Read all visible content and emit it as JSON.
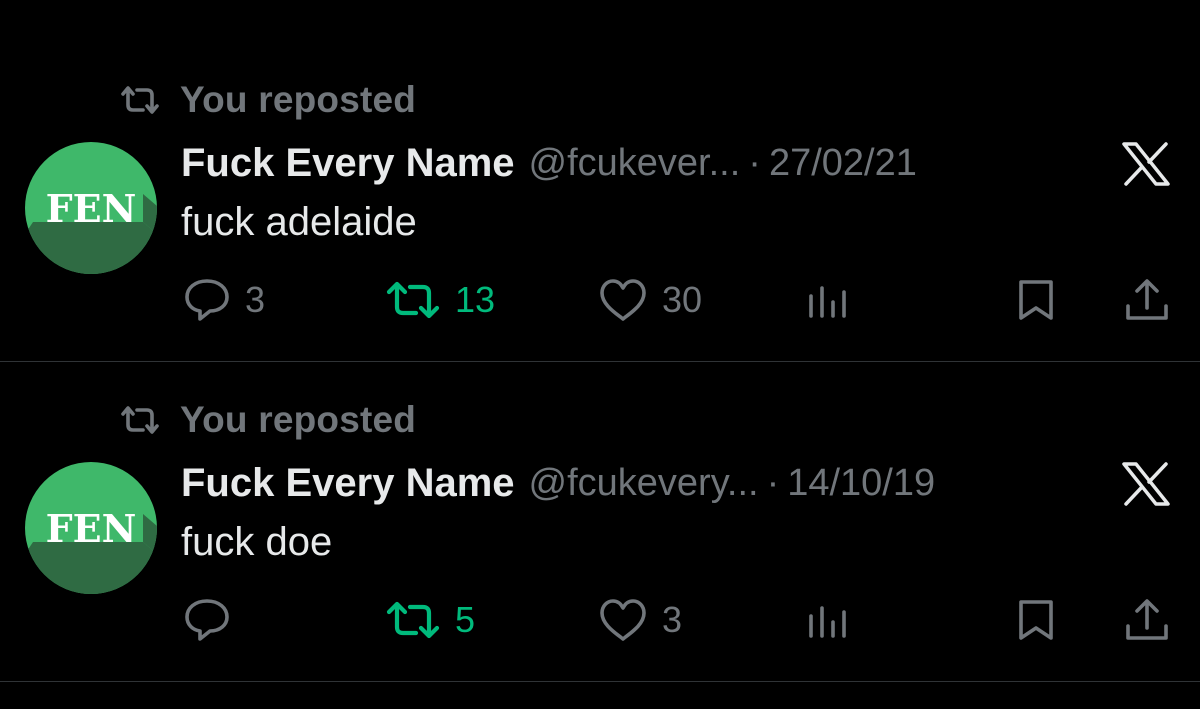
{
  "colors": {
    "background": "#000000",
    "primary_text": "#e7e9ea",
    "secondary_text": "#71767b",
    "retweet_active": "#00ba7c",
    "divider": "#2f3336",
    "avatar_green": "#3fb86a",
    "avatar_dark_green": "#2f6b43"
  },
  "posts": [
    {
      "repost_label": "You reposted",
      "avatar_text": "FEN",
      "display_name": "Fuck Every Name",
      "handle": "@fcukever...",
      "separator": "·",
      "date": "27/02/21",
      "text": "fuck adelaide",
      "replies": "3",
      "retweets": "13",
      "likes": "30",
      "retweeted": true
    },
    {
      "repost_label": "You reposted",
      "avatar_text": "FEN",
      "display_name": "Fuck Every Name",
      "handle": "@fcukevery...",
      "separator": "·",
      "date": "14/10/19",
      "text": "fuck doe",
      "replies": "",
      "retweets": "5",
      "likes": "3",
      "retweeted": true
    }
  ],
  "icons": {
    "repost": "repost-icon",
    "x_logo": "x-logo-icon",
    "reply": "reply-icon",
    "retweet": "retweet-icon",
    "like": "heart-icon",
    "views": "views-icon",
    "bookmark": "bookmark-icon",
    "share": "share-icon"
  }
}
